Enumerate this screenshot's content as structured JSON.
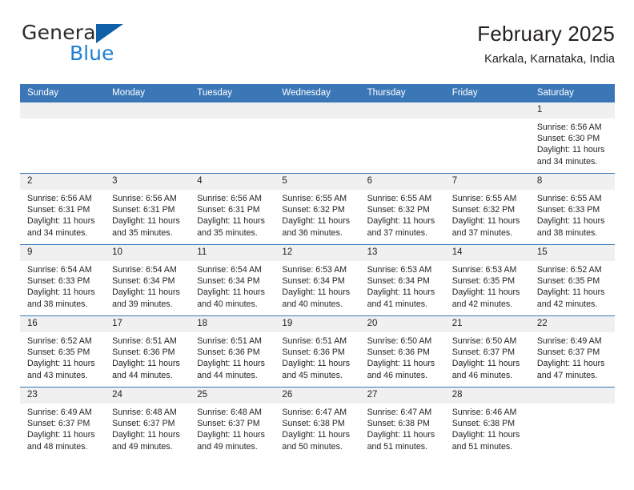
{
  "brand": {
    "word_primary": "General",
    "word_secondary": "Blue",
    "triangle_color": "#1060a8",
    "secondary_color": "#1f7fd0"
  },
  "header": {
    "title": "February 2025",
    "subtitle": "Karkala, Karnataka, India"
  },
  "theme": {
    "header_blue": "#3b77b7",
    "daynum_band": "#f0f0f0",
    "text": "#231f20"
  },
  "weekday_headers": [
    "Sunday",
    "Monday",
    "Tuesday",
    "Wednesday",
    "Thursday",
    "Friday",
    "Saturday"
  ],
  "labels": {
    "sunrise_prefix": "Sunrise:",
    "sunset_prefix": "Sunset:",
    "daylight_prefix": "Daylight:"
  },
  "weeks": [
    [
      {
        "day": "",
        "empty": true
      },
      {
        "day": "",
        "empty": true
      },
      {
        "day": "",
        "empty": true
      },
      {
        "day": "",
        "empty": true
      },
      {
        "day": "",
        "empty": true
      },
      {
        "day": "",
        "empty": true
      },
      {
        "day": "1",
        "sunrise": "Sunrise: 6:56 AM",
        "sunset": "Sunset: 6:30 PM",
        "daylight_1": "Daylight: 11 hours",
        "daylight_2": "and 34 minutes."
      }
    ],
    [
      {
        "day": "2",
        "sunrise": "Sunrise: 6:56 AM",
        "sunset": "Sunset: 6:31 PM",
        "daylight_1": "Daylight: 11 hours",
        "daylight_2": "and 34 minutes."
      },
      {
        "day": "3",
        "sunrise": "Sunrise: 6:56 AM",
        "sunset": "Sunset: 6:31 PM",
        "daylight_1": "Daylight: 11 hours",
        "daylight_2": "and 35 minutes."
      },
      {
        "day": "4",
        "sunrise": "Sunrise: 6:56 AM",
        "sunset": "Sunset: 6:31 PM",
        "daylight_1": "Daylight: 11 hours",
        "daylight_2": "and 35 minutes."
      },
      {
        "day": "5",
        "sunrise": "Sunrise: 6:55 AM",
        "sunset": "Sunset: 6:32 PM",
        "daylight_1": "Daylight: 11 hours",
        "daylight_2": "and 36 minutes."
      },
      {
        "day": "6",
        "sunrise": "Sunrise: 6:55 AM",
        "sunset": "Sunset: 6:32 PM",
        "daylight_1": "Daylight: 11 hours",
        "daylight_2": "and 37 minutes."
      },
      {
        "day": "7",
        "sunrise": "Sunrise: 6:55 AM",
        "sunset": "Sunset: 6:32 PM",
        "daylight_1": "Daylight: 11 hours",
        "daylight_2": "and 37 minutes."
      },
      {
        "day": "8",
        "sunrise": "Sunrise: 6:55 AM",
        "sunset": "Sunset: 6:33 PM",
        "daylight_1": "Daylight: 11 hours",
        "daylight_2": "and 38 minutes."
      }
    ],
    [
      {
        "day": "9",
        "sunrise": "Sunrise: 6:54 AM",
        "sunset": "Sunset: 6:33 PM",
        "daylight_1": "Daylight: 11 hours",
        "daylight_2": "and 38 minutes."
      },
      {
        "day": "10",
        "sunrise": "Sunrise: 6:54 AM",
        "sunset": "Sunset: 6:34 PM",
        "daylight_1": "Daylight: 11 hours",
        "daylight_2": "and 39 minutes."
      },
      {
        "day": "11",
        "sunrise": "Sunrise: 6:54 AM",
        "sunset": "Sunset: 6:34 PM",
        "daylight_1": "Daylight: 11 hours",
        "daylight_2": "and 40 minutes."
      },
      {
        "day": "12",
        "sunrise": "Sunrise: 6:53 AM",
        "sunset": "Sunset: 6:34 PM",
        "daylight_1": "Daylight: 11 hours",
        "daylight_2": "and 40 minutes."
      },
      {
        "day": "13",
        "sunrise": "Sunrise: 6:53 AM",
        "sunset": "Sunset: 6:34 PM",
        "daylight_1": "Daylight: 11 hours",
        "daylight_2": "and 41 minutes."
      },
      {
        "day": "14",
        "sunrise": "Sunrise: 6:53 AM",
        "sunset": "Sunset: 6:35 PM",
        "daylight_1": "Daylight: 11 hours",
        "daylight_2": "and 42 minutes."
      },
      {
        "day": "15",
        "sunrise": "Sunrise: 6:52 AM",
        "sunset": "Sunset: 6:35 PM",
        "daylight_1": "Daylight: 11 hours",
        "daylight_2": "and 42 minutes."
      }
    ],
    [
      {
        "day": "16",
        "sunrise": "Sunrise: 6:52 AM",
        "sunset": "Sunset: 6:35 PM",
        "daylight_1": "Daylight: 11 hours",
        "daylight_2": "and 43 minutes."
      },
      {
        "day": "17",
        "sunrise": "Sunrise: 6:51 AM",
        "sunset": "Sunset: 6:36 PM",
        "daylight_1": "Daylight: 11 hours",
        "daylight_2": "and 44 minutes."
      },
      {
        "day": "18",
        "sunrise": "Sunrise: 6:51 AM",
        "sunset": "Sunset: 6:36 PM",
        "daylight_1": "Daylight: 11 hours",
        "daylight_2": "and 44 minutes."
      },
      {
        "day": "19",
        "sunrise": "Sunrise: 6:51 AM",
        "sunset": "Sunset: 6:36 PM",
        "daylight_1": "Daylight: 11 hours",
        "daylight_2": "and 45 minutes."
      },
      {
        "day": "20",
        "sunrise": "Sunrise: 6:50 AM",
        "sunset": "Sunset: 6:36 PM",
        "daylight_1": "Daylight: 11 hours",
        "daylight_2": "and 46 minutes."
      },
      {
        "day": "21",
        "sunrise": "Sunrise: 6:50 AM",
        "sunset": "Sunset: 6:37 PM",
        "daylight_1": "Daylight: 11 hours",
        "daylight_2": "and 46 minutes."
      },
      {
        "day": "22",
        "sunrise": "Sunrise: 6:49 AM",
        "sunset": "Sunset: 6:37 PM",
        "daylight_1": "Daylight: 11 hours",
        "daylight_2": "and 47 minutes."
      }
    ],
    [
      {
        "day": "23",
        "sunrise": "Sunrise: 6:49 AM",
        "sunset": "Sunset: 6:37 PM",
        "daylight_1": "Daylight: 11 hours",
        "daylight_2": "and 48 minutes."
      },
      {
        "day": "24",
        "sunrise": "Sunrise: 6:48 AM",
        "sunset": "Sunset: 6:37 PM",
        "daylight_1": "Daylight: 11 hours",
        "daylight_2": "and 49 minutes."
      },
      {
        "day": "25",
        "sunrise": "Sunrise: 6:48 AM",
        "sunset": "Sunset: 6:37 PM",
        "daylight_1": "Daylight: 11 hours",
        "daylight_2": "and 49 minutes."
      },
      {
        "day": "26",
        "sunrise": "Sunrise: 6:47 AM",
        "sunset": "Sunset: 6:38 PM",
        "daylight_1": "Daylight: 11 hours",
        "daylight_2": "and 50 minutes."
      },
      {
        "day": "27",
        "sunrise": "Sunrise: 6:47 AM",
        "sunset": "Sunset: 6:38 PM",
        "daylight_1": "Daylight: 11 hours",
        "daylight_2": "and 51 minutes."
      },
      {
        "day": "28",
        "sunrise": "Sunrise: 6:46 AM",
        "sunset": "Sunset: 6:38 PM",
        "daylight_1": "Daylight: 11 hours",
        "daylight_2": "and 51 minutes."
      },
      {
        "day": "",
        "empty": true
      }
    ]
  ]
}
